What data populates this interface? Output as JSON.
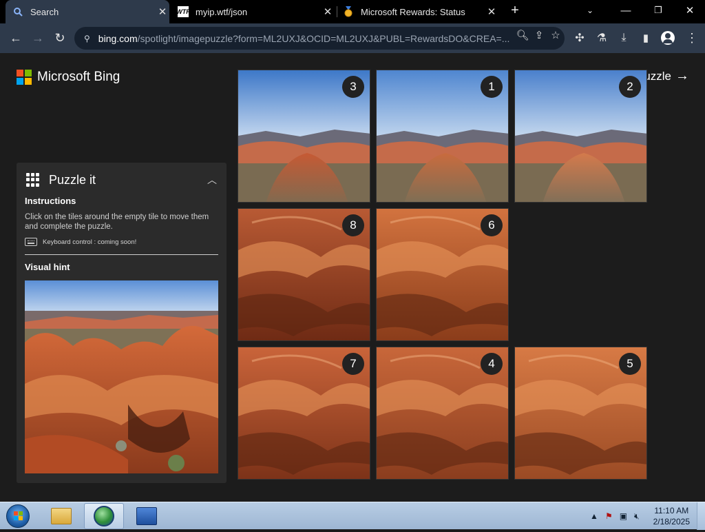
{
  "browser": {
    "tabs": [
      {
        "title": "Search",
        "favicon": "search-icon"
      },
      {
        "title": "myip.wtf/json",
        "favicon": "wtf-favicon",
        "favicon_text": "WTF"
      },
      {
        "title": "Microsoft Rewards: Status",
        "favicon": "rewards-medal-icon"
      }
    ],
    "new_tab_label": "+",
    "url_domain": "bing.com",
    "url_rest": "/spotlight/imagepuzzle?form=ML2UXJ&OCID=ML2UXJ&PUBL=RewardsDO&CREA=..."
  },
  "page": {
    "brand": "Microsoft Bing",
    "brand_colors": [
      "#f25022",
      "#7fba00",
      "#00a4ef",
      "#ffb900"
    ],
    "skip_label": "Skip puzzle",
    "skip_arrow": "→",
    "panel": {
      "title": "Puzzle it",
      "instructions_heading": "Instructions",
      "instructions_text": "Click on the tiles around the empty tile to move them and complete the puzzle.",
      "keyboard_note": "Keyboard control : coming soon!",
      "visual_hint_heading": "Visual hint"
    },
    "tiles": [
      {
        "number": "3",
        "row": 0,
        "col": 0
      },
      {
        "number": "1",
        "row": 0,
        "col": 1
      },
      {
        "number": "2",
        "row": 0,
        "col": 2
      },
      {
        "number": "8",
        "row": 1,
        "col": 0
      },
      {
        "number": "6",
        "row": 1,
        "col": 1
      },
      {
        "number": "7",
        "row": 2,
        "col": 0
      },
      {
        "number": "4",
        "row": 2,
        "col": 1
      },
      {
        "number": "5",
        "row": 2,
        "col": 2
      }
    ],
    "empty_slot": {
      "row": 1,
      "col": 2
    }
  },
  "taskbar": {
    "time": "11:10 AM",
    "date": "2/18/2025"
  }
}
